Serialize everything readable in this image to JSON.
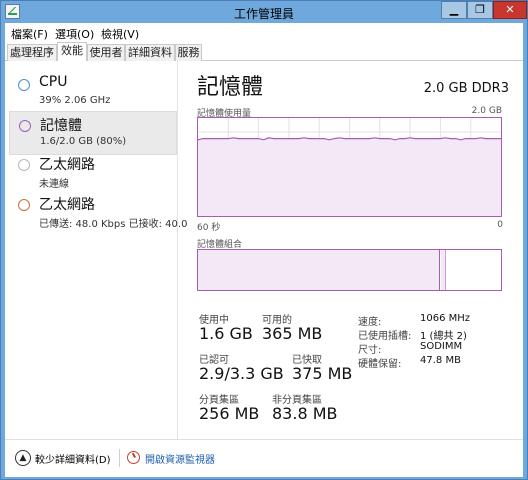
{
  "window": {
    "title": "工作管理員"
  },
  "window_controls": {
    "minimize": "▁",
    "maximize": "❐",
    "close": "✕"
  },
  "menu": [
    {
      "label": "檔案(F)"
    },
    {
      "label": "選項(O)"
    },
    {
      "label": "檢視(V)"
    }
  ],
  "tabs": [
    {
      "label": "處理程序",
      "active": false
    },
    {
      "label": "效能",
      "active": true
    },
    {
      "label": "使用者",
      "active": false
    },
    {
      "label": "詳細資料",
      "active": false
    },
    {
      "label": "服務",
      "active": false
    }
  ],
  "resources": [
    {
      "name": "CPU",
      "sub": "39% 2.06 GHz",
      "color": "#4f8fd1",
      "selected": false
    },
    {
      "name": "記憶體",
      "sub": "1.6/2.0 GB (80%)",
      "color": "#a05cb5",
      "selected": true
    },
    {
      "name": "乙太網路",
      "sub": "未連線",
      "color": "#b8b8b8",
      "selected": false
    },
    {
      "name": "乙太網路",
      "sub": "已傳送: 48.0 Kbps 已接收: 40.0",
      "color": "#c9723a",
      "selected": false
    }
  ],
  "memory": {
    "title": "記憶體",
    "spec": "2.0 GB DDR3",
    "usage_label": "記憶體使用量",
    "usage_max": "2.0 GB",
    "time_label": "60 秒",
    "zero_label": "0",
    "composition_label": "記憶體組合",
    "stats": {
      "in_use": {
        "label": "使用中",
        "value": "1.6 GB"
      },
      "available": {
        "label": "可用的",
        "value": "365 MB"
      },
      "committed": {
        "label": "已認可",
        "value": "2.9/3.3 GB"
      },
      "cached": {
        "label": "已快取",
        "value": "375 MB"
      },
      "paged_pool": {
        "label": "分頁集區",
        "value": "256 MB"
      },
      "non_paged_pool": {
        "label": "非分頁集區",
        "value": "83.8 MB"
      }
    },
    "info": [
      {
        "key": "速度:",
        "value": "1066 MHz"
      },
      {
        "key": "已使用插槽:",
        "value": "1 (總共 2)"
      },
      {
        "key": "尺寸:",
        "value": "SODIMM"
      },
      {
        "key": "硬體保留:",
        "value": "47.8 MB"
      }
    ],
    "usage_fraction": 0.8,
    "composition": {
      "in_use_fraction": 0.8,
      "modified_fraction": 0.015
    },
    "accent_color": "#a85bb3"
  },
  "footer": {
    "fewer_details": "較少詳細資料(D)",
    "open_monitor": "開啟資源監視器"
  },
  "icons": {
    "app": "task-manager-icon",
    "collapse": "chevron-up-icon",
    "monitor": "resource-monitor-icon"
  }
}
